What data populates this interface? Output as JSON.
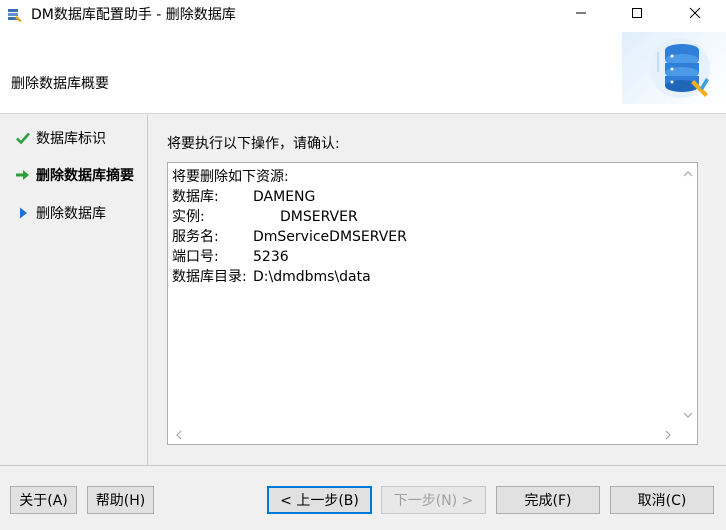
{
  "window": {
    "title": "DM数据库配置助手 - 删除数据库"
  },
  "header": {
    "title": "删除数据库概要"
  },
  "steps": [
    {
      "label": "数据库标识",
      "state": "done",
      "icon": "checkmark-icon"
    },
    {
      "label": "删除数据库摘要",
      "state": "current",
      "icon": "arrow-right-icon"
    },
    {
      "label": "删除数据库",
      "state": "pending",
      "icon": "triangle-right-icon"
    }
  ],
  "main": {
    "prompt": "将要执行以下操作，请确认:",
    "summary": {
      "heading": "将要删除如下资源:",
      "rows": [
        {
          "label": "数据库:",
          "value": "DAMENG"
        },
        {
          "label": "实例:",
          "value": "DMSERVER"
        },
        {
          "label": "服务名:",
          "value": "DmServiceDMSERVER"
        },
        {
          "label": "端口号:",
          "value": "5236"
        },
        {
          "label": "数据库目录:",
          "value": "D:\\dmdbms\\data"
        }
      ]
    }
  },
  "buttons": {
    "about": "关于(A)",
    "help": "帮助(H)",
    "prev": "< 上一步(B)",
    "next": "下一步(N) >",
    "finish": "完成(F)",
    "cancel": "取消(C)"
  },
  "colors": {
    "done": "#2e9e3b",
    "current": "#2e9e3b",
    "pending": "#1e73d8",
    "accent": "#0078d7"
  }
}
